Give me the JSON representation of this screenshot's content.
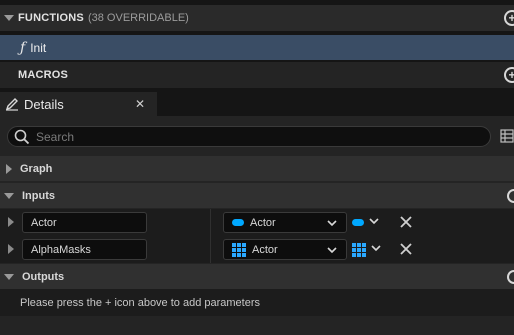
{
  "blueprint": {
    "functions": {
      "title": "FUNCTIONS",
      "count_label": "(38 OVERRIDABLE)"
    },
    "function_items": [
      {
        "icon": "function-icon",
        "glyph": "ƒ",
        "label": "Init"
      }
    ],
    "macros": {
      "title": "MACROS"
    }
  },
  "details": {
    "tab": {
      "title": "Details",
      "close_glyph": "✕"
    },
    "search": {
      "placeholder": "Search"
    },
    "categories": {
      "graph": "Graph",
      "inputs": "Inputs",
      "outputs": "Outputs"
    },
    "inputs": [
      {
        "name": "Actor",
        "type": "Actor",
        "container": "single"
      },
      {
        "name": "AlphaMasks",
        "type": "Actor",
        "container": "array"
      }
    ],
    "outputs_message": "Please press the + icon above to add parameters"
  },
  "colors": {
    "selected_row": "#3a4d65",
    "object_type": "#00a8ff",
    "highlight_underline": "#e8232a"
  }
}
